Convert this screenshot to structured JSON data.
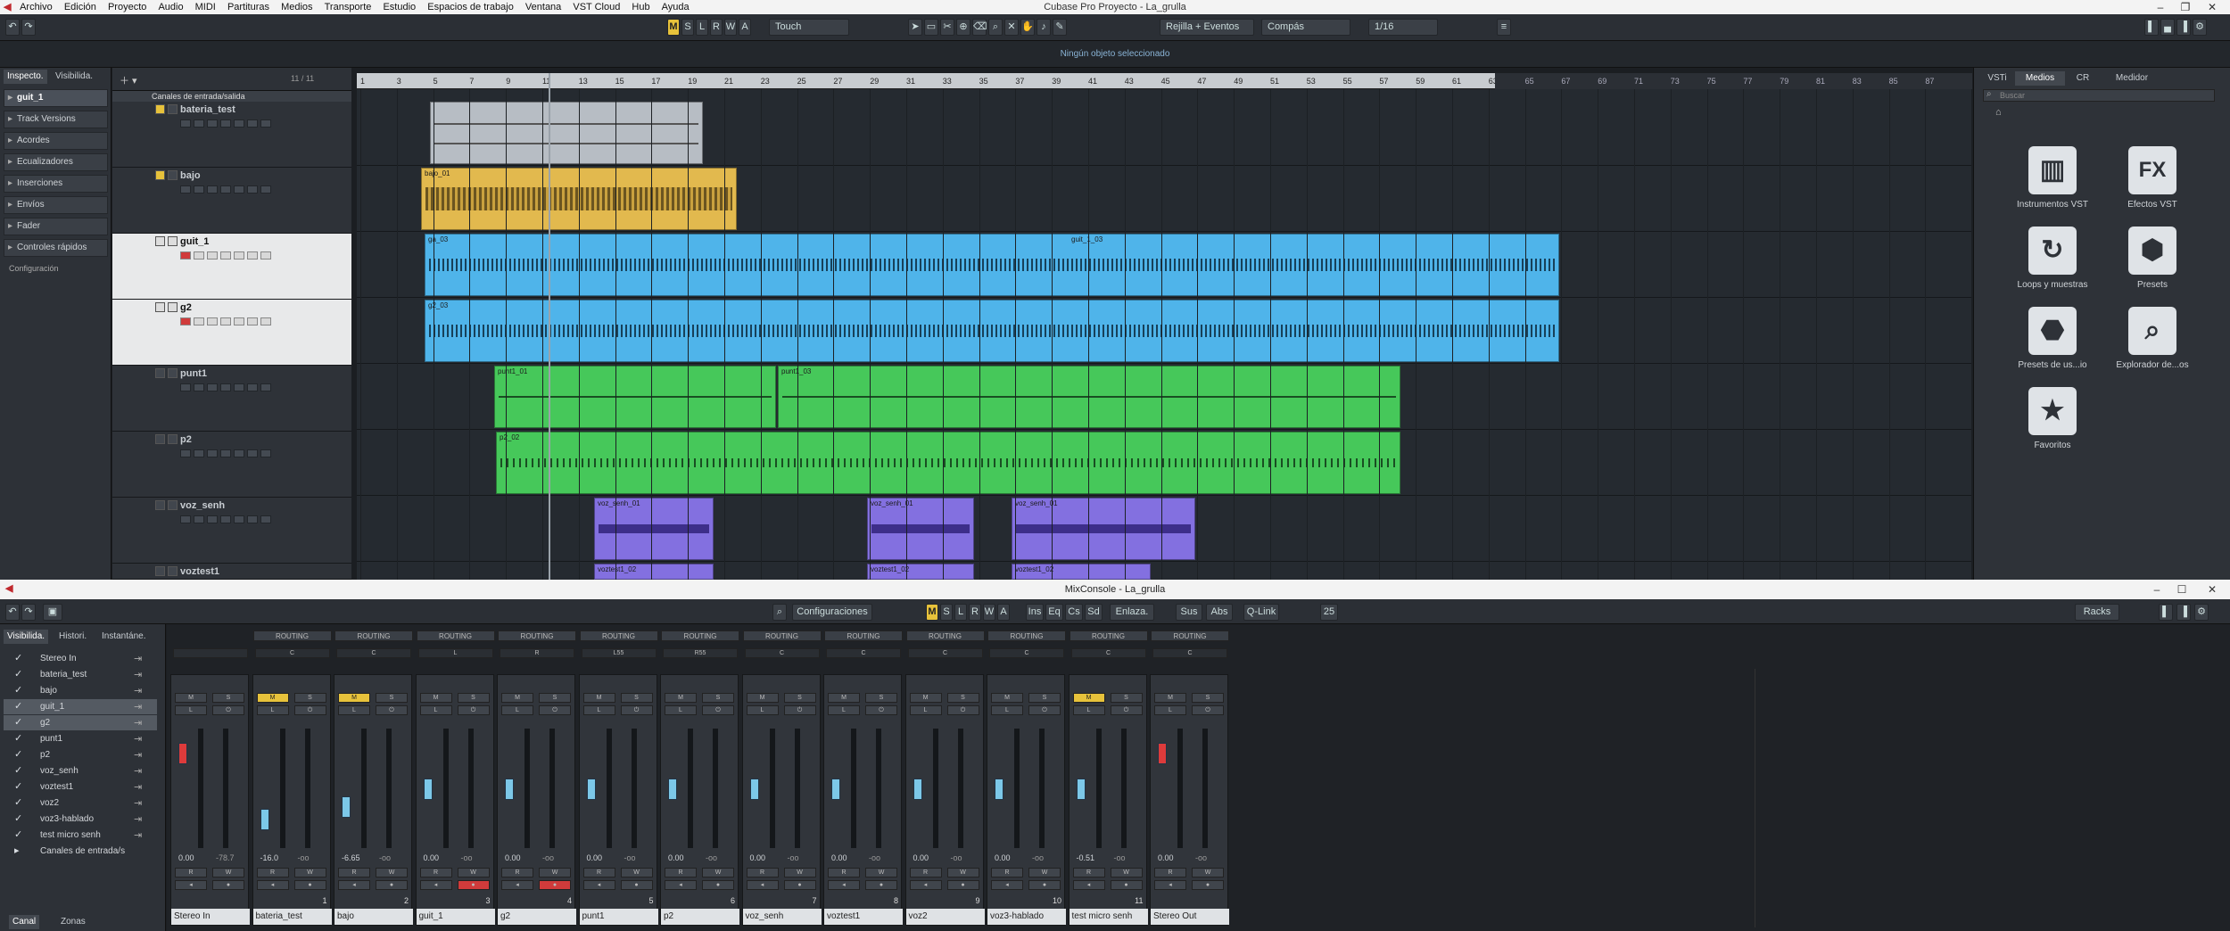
{
  "app": {
    "title": "Cubase Pro Proyecto - La_grulla",
    "menu": [
      "Archivo",
      "Edición",
      "Proyecto",
      "Audio",
      "MIDI",
      "Partituras",
      "Medios",
      "Transporte",
      "Estudio",
      "Espacios de trabajo",
      "Ventana",
      "Hub",
      "VST Cloud",
      "Ayuda"
    ]
  },
  "toolbar": {
    "m": "M",
    "s": "S",
    "l": "L",
    "r": "R",
    "w": "W",
    "a": "A",
    "automation_mode": "Touch",
    "snap": "Rejilla + Eventos",
    "grid_type": "Compás",
    "quantize": "1/16"
  },
  "infoline": {
    "text": "Ningún objeto seleccionado"
  },
  "inspector": {
    "tabs": [
      "Inspecto.",
      "Visibilida."
    ],
    "track": "guit_1",
    "sections": [
      "Track Versions",
      "Acordes",
      "Ecualizadores",
      "Inserciones",
      "Envíos",
      "Fader",
      "Controles rápidos"
    ],
    "config": "Configuración"
  },
  "tracklist": {
    "header": "Canales de entrada/salida",
    "count": "11 / 11",
    "tracks": [
      {
        "name": "bateria_test"
      },
      {
        "name": "bajo"
      },
      {
        "name": "guit_1"
      },
      {
        "name": "g2"
      },
      {
        "name": "punt1"
      },
      {
        "name": "p2"
      },
      {
        "name": "voz_senh"
      },
      {
        "name": "voztest1"
      }
    ]
  },
  "ruler": {
    "bars": [
      "1",
      "3",
      "5",
      "7",
      "9",
      "11",
      "13",
      "15",
      "17",
      "19",
      "21",
      "23",
      "25",
      "27",
      "29",
      "31",
      "33",
      "35",
      "37",
      "39",
      "41",
      "43",
      "45",
      "47",
      "49",
      "51",
      "53",
      "55",
      "57",
      "59",
      "61",
      "63",
      "65",
      "67",
      "69",
      "71",
      "73",
      "75",
      "77",
      "79",
      "81",
      "83",
      "85",
      "87"
    ]
  },
  "clips": {
    "bajo": "bajo_01",
    "guit": "ga_03",
    "guit2": "guit_1_03",
    "g2": "g2_03",
    "punt_a": "punt1_01",
    "punt_b": "punt1_03",
    "p2": "p2_02",
    "voz_a": "voz_senh_01",
    "voz_b": "voz_senh_01",
    "voz_c": "voz_senh_01",
    "vt_a": "voztest1_02",
    "vt_b": "voztest1_02",
    "vt_c": "voztest1_02"
  },
  "rightzone": {
    "tabs": [
      "VSTi",
      "Medios",
      "CR",
      "Medidor"
    ],
    "search": "Buscar",
    "items": [
      {
        "label": "Instrumentos VST",
        "icon": "piano-icon"
      },
      {
        "label": "Efectos VST",
        "icon": "fx-icon"
      },
      {
        "label": "Loops y muestras",
        "icon": "loop-icon"
      },
      {
        "label": "Presets",
        "icon": "presets-icon"
      },
      {
        "label": "Presets de us...io",
        "icon": "user-presets-icon"
      },
      {
        "label": "Explorador de...os",
        "icon": "browser-icon"
      },
      {
        "label": "Favoritos",
        "icon": "star-icon"
      }
    ]
  },
  "mixconsole": {
    "title": "MixConsole - La_grulla",
    "configs": "Configuraciones",
    "links": [
      "Ins",
      "Eq",
      "Cs",
      "Sd"
    ],
    "enlaza": "Enlaza.",
    "sus": "Sus",
    "abs": "Abs",
    "qlink": "Q-Link",
    "zoom": "25",
    "racks": "Racks",
    "left_tabs": [
      "Visibilida.",
      "Histori.",
      "Instantáne."
    ],
    "bottom_tabs": [
      "Canal",
      "Zonas"
    ],
    "visibility": [
      {
        "label": "Stereo In"
      },
      {
        "label": "bateria_test"
      },
      {
        "label": "bajo"
      },
      {
        "label": "guit_1"
      },
      {
        "label": "g2"
      },
      {
        "label": "punt1"
      },
      {
        "label": "p2"
      },
      {
        "label": "voz_senh"
      },
      {
        "label": "voztest1"
      },
      {
        "label": "voz2"
      },
      {
        "label": "voz3-hablado"
      },
      {
        "label": "test micro senh"
      },
      {
        "label": "Canales de entrada/s"
      }
    ],
    "routing": "ROUTING",
    "channels": [
      {
        "name": "Stereo In",
        "num": "",
        "val": "0.00",
        "peak": "-78.7",
        "pan": ""
      },
      {
        "name": "bateria_test",
        "num": "1",
        "val": "-16.0",
        "peak": "-oo",
        "pan": "C"
      },
      {
        "name": "bajo",
        "num": "2",
        "val": "-6.65",
        "peak": "-oo",
        "pan": "C"
      },
      {
        "name": "guit_1",
        "num": "3",
        "val": "0.00",
        "peak": "-oo",
        "pan": "L"
      },
      {
        "name": "g2",
        "num": "4",
        "val": "0.00",
        "peak": "-oo",
        "pan": "R"
      },
      {
        "name": "punt1",
        "num": "5",
        "val": "0.00",
        "peak": "-oo",
        "pan": "L55"
      },
      {
        "name": "p2",
        "num": "6",
        "val": "0.00",
        "peak": "-oo",
        "pan": "R55"
      },
      {
        "name": "voz_senh",
        "num": "7",
        "val": "0.00",
        "peak": "-oo",
        "pan": "C"
      },
      {
        "name": "voztest1",
        "num": "8",
        "val": "0.00",
        "peak": "-oo",
        "pan": "C"
      },
      {
        "name": "voz2",
        "num": "9",
        "val": "0.00",
        "peak": "-oo",
        "pan": "C"
      },
      {
        "name": "voz3-hablado",
        "num": "10",
        "val": "0.00",
        "peak": "-oo",
        "pan": "C"
      },
      {
        "name": "test micro senh",
        "num": "11",
        "val": "-0.51",
        "peak": "-oo",
        "pan": "C"
      },
      {
        "name": "Stereo Out",
        "num": "",
        "val": "0.00",
        "peak": "-oo",
        "pan": "C"
      }
    ]
  }
}
